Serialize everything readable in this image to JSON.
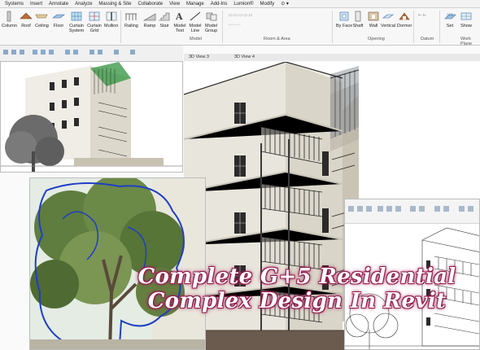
{
  "menu": {
    "items": [
      "Systems",
      "Insert",
      "Annotate",
      "Analyze",
      "Massing & Site",
      "Collaborate",
      "View",
      "Manage",
      "Add-Ins",
      "Lumion®",
      "Modify"
    ]
  },
  "ribbon": {
    "tools": [
      "Column",
      "Roof",
      "Ceiling",
      "Floor",
      "Curtain System",
      "Curtain Grid",
      "Mullion",
      "Railing",
      "Ramp",
      "Stair",
      "Model Text",
      "Model Line",
      "Model Group",
      "By Face",
      "Shaft",
      "Wall",
      "Vertical",
      "Dormer",
      "Set",
      "Show"
    ],
    "groups": [
      "Model",
      "Room & Area",
      "Opening",
      "Datum",
      "Work Plane"
    ]
  },
  "tabs": [
    "3D View 3",
    "3D View 4"
  ],
  "title": {
    "line1": "Complete G+5 Residential",
    "line2": "Complex Design In Revit"
  },
  "colors": {
    "title_fill": "#ffffff",
    "title_outline": "#9c1c50",
    "ribbon_bg": "#f7f7f7",
    "building_wall": "#e9e6dc",
    "railing": "#2a2a2a",
    "tree_outline": "#1f3fc4"
  }
}
